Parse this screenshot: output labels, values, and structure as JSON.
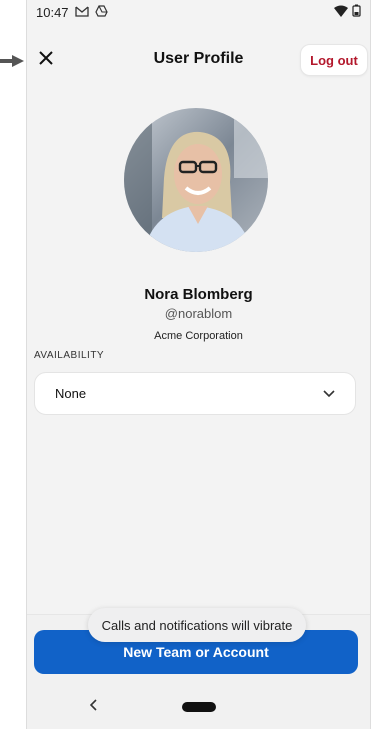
{
  "status": {
    "time": "10:47"
  },
  "header": {
    "title": "User Profile",
    "logout_label": "Log out"
  },
  "profile": {
    "name": "Nora Blomberg",
    "handle": "@norablom",
    "organization": "Acme Corporation"
  },
  "availability": {
    "label": "AVAILABILITY",
    "value": "None"
  },
  "actions": {
    "primary_label": "New Team or Account"
  },
  "toast": {
    "message": "Calls and notifications will vibrate"
  },
  "colors": {
    "accent": "#1162c8",
    "logout": "#b3182c",
    "background": "#f3f3f3"
  }
}
